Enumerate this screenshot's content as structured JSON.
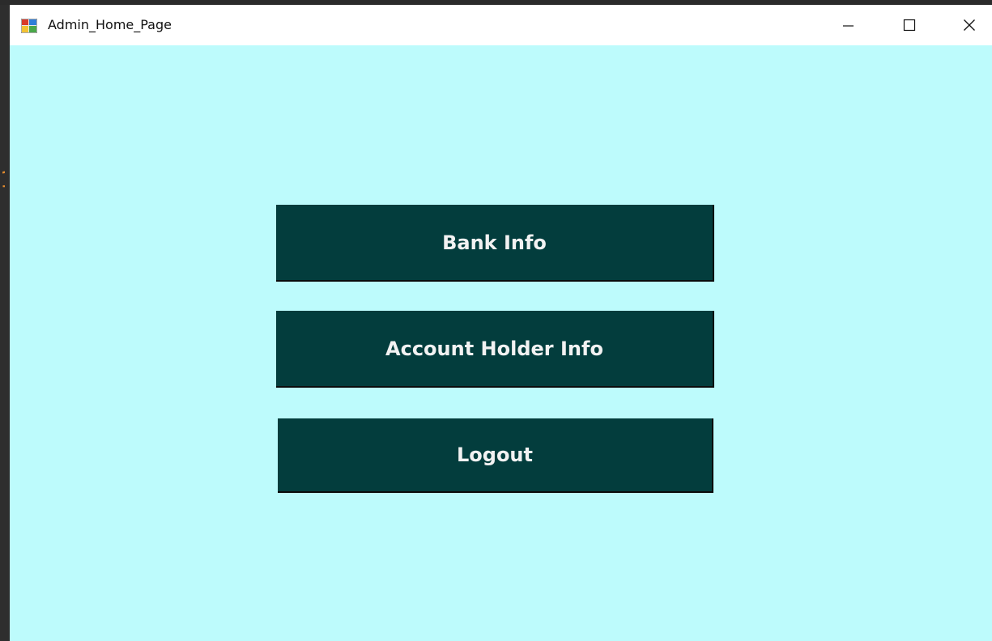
{
  "window": {
    "title": "Admin_Home_Page",
    "icon": "winforms-app-icon",
    "controls": {
      "minimize_icon": "minimize-icon",
      "maximize_icon": "maximize-icon",
      "close_icon": "close-icon"
    }
  },
  "menu": {
    "bank_info_label": "Bank Info",
    "account_holder_info_label": "Account Holder Info",
    "logout_label": "Logout"
  },
  "colors": {
    "background": "#bdfbfc",
    "button": "#033d3d",
    "button_text": "#f2f2f2",
    "titlebar": "#ffffff"
  }
}
